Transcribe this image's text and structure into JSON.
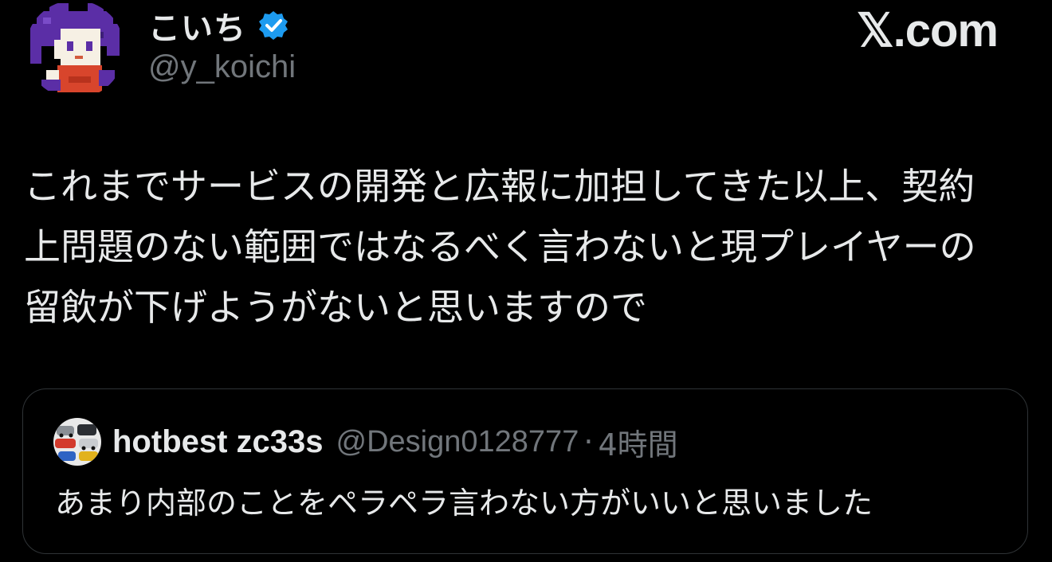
{
  "author": {
    "display_name": "こいち",
    "handle": "@y_koichi",
    "verified": true
  },
  "brand": "𝕏.com",
  "tweet": {
    "text": "これまでサービスの開発と広報に加担してきた以上、契約\n上問題のない範囲ではなるべく言わないと現プレイヤーの\n留飲が下げようがないと思いますので"
  },
  "quote": {
    "display_name": "hotbest zc33s",
    "handle": "@Design0128777",
    "separator": "·",
    "time": "4時間",
    "text": "あまり内部のことをペラペラ言わない方がいいと思いました"
  },
  "colors": {
    "background": "#000000",
    "text_primary": "#e7e9ea",
    "text_secondary": "#71767b",
    "verified_badge": "#1d9bf0",
    "card_border": "#2f3336"
  },
  "icons": {
    "avatar": "pixel-art-character-avatar",
    "verified": "verified-badge-icon",
    "quote_avatar": "cars-photo-avatar"
  }
}
